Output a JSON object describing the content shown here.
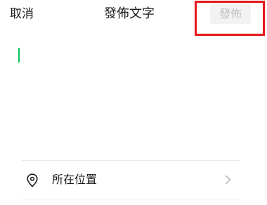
{
  "header": {
    "cancel_label": "取消",
    "title": "發佈文字",
    "publish_label": "發佈"
  },
  "composer": {
    "text": ""
  },
  "location": {
    "label": "所在位置",
    "icon": "location-pin-icon",
    "chevron": "chevron-right-icon"
  },
  "colors": {
    "accent": "#07c160",
    "highlight": "#e8161a",
    "publish_disabled_bg": "#f2f2f2",
    "publish_disabled_text": "#c0c0c0"
  }
}
